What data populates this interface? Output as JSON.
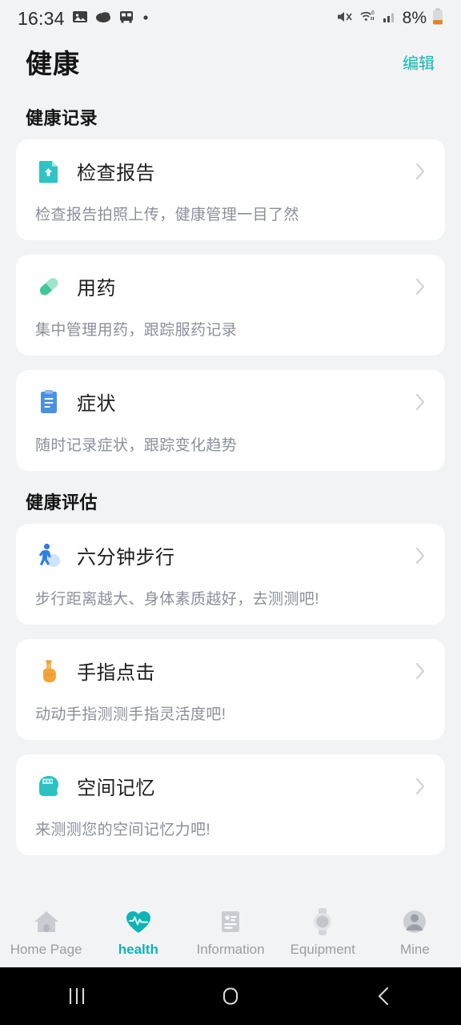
{
  "status_bar": {
    "time": "16:34",
    "battery_text": "8%",
    "left_icons": [
      "photo-icon",
      "palette-icon",
      "bus-icon",
      "dot-icon"
    ],
    "right_icons": [
      "mute-icon",
      "wifi-icon",
      "signal-icon",
      "battery-icon"
    ]
  },
  "app_bar": {
    "title": "健康",
    "edit_label": "编辑",
    "accent_color": "#15b5b0"
  },
  "sections": [
    {
      "title": "健康记录",
      "cards": [
        {
          "icon": "report-document-icon",
          "title": "检查报告",
          "desc": "检查报告拍照上传，健康管理一目了然"
        },
        {
          "icon": "medicine-capsule-icon",
          "title": "用药",
          "desc": "集中管理用药，跟踪服药记录"
        },
        {
          "icon": "symptom-clipboard-icon",
          "title": "症状",
          "desc": "随时记录症状，跟踪变化趋势"
        }
      ]
    },
    {
      "title": "健康评估",
      "cards": [
        {
          "icon": "walking-person-icon",
          "title": "六分钟步行",
          "desc": "步行距离越大、身体素质越好，去测测吧!"
        },
        {
          "icon": "tapping-finger-icon",
          "title": "手指点击",
          "desc": "动动手指测测手指灵活度吧!"
        },
        {
          "icon": "brain-head-icon",
          "title": "空间记忆",
          "desc": "来测测您的空间记忆力吧!"
        }
      ]
    }
  ],
  "tab_bar": {
    "active_color": "#0fb3b3",
    "inactive_color": "#9a9da3",
    "items": [
      {
        "icon": "home-icon",
        "label": "Home Page",
        "active": false
      },
      {
        "icon": "heart-pulse-icon",
        "label": "health",
        "active": true
      },
      {
        "icon": "information-icon",
        "label": "Information",
        "active": false
      },
      {
        "icon": "watch-icon",
        "label": "Equipment",
        "active": false
      },
      {
        "icon": "person-icon",
        "label": "Mine",
        "active": false
      }
    ]
  },
  "nav_bar": {
    "buttons": [
      "recents-icon",
      "home-circle-icon",
      "back-icon"
    ]
  }
}
